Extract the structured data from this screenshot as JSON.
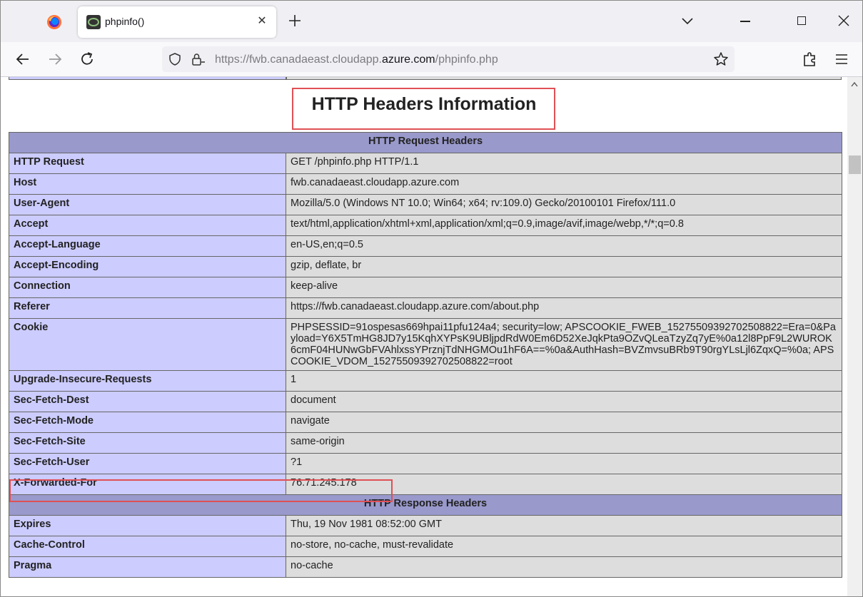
{
  "browser": {
    "tab_title": "phpinfo()",
    "url_prefix": "https://fwb.canadaeast.cloudapp.",
    "url_domain": "azure.com",
    "url_path": "/phpinfo.php"
  },
  "page": {
    "section_title": "HTTP Headers Information",
    "request_header_title": "HTTP Request Headers",
    "response_header_title": "HTTP Response Headers",
    "request_rows": [
      {
        "name": "HTTP Request",
        "value": "GET /phpinfo.php HTTP/1.1"
      },
      {
        "name": "Host",
        "value": "fwb.canadaeast.cloudapp.azure.com"
      },
      {
        "name": "User-Agent",
        "value": "Mozilla/5.0 (Windows NT 10.0; Win64; x64; rv:109.0) Gecko/20100101 Firefox/111.0"
      },
      {
        "name": "Accept",
        "value": "text/html,application/xhtml+xml,application/xml;q=0.9,image/avif,image/webp,*/*;q=0.8"
      },
      {
        "name": "Accept-Language",
        "value": "en-US,en;q=0.5"
      },
      {
        "name": "Accept-Encoding",
        "value": "gzip, deflate, br"
      },
      {
        "name": "Connection",
        "value": "keep-alive"
      },
      {
        "name": "Referer",
        "value": "https://fwb.canadaeast.cloudapp.azure.com/about.php"
      },
      {
        "name": "Cookie",
        "value": "PHPSESSID=91ospesas669hpai11pfu124a4; security=low; APSCOOKIE_FWEB_1527550939270250882​2=Era=0&Payload=Y6X5TmHG8JD7y15KqhXYPsK9UBljpdRdW0Em6D52XeJqkPta9OZvQLeaTzyZq7yE%0a12l8PpF9L2WUROK6cmF04HUNwGbFVAhlxssYPrznjTdNHGMOu1hF6A==%0a&AuthHash=BVZmvsuBRb9T90rgYLsLjl6ZqxQ=%0a; APSCOOKIE_VDOM_1527550939270250882​2=root"
      },
      {
        "name": "Upgrade-Insecure-Requests",
        "value": "1"
      },
      {
        "name": "Sec-Fetch-Dest",
        "value": "document"
      },
      {
        "name": "Sec-Fetch-Mode",
        "value": "navigate"
      },
      {
        "name": "Sec-Fetch-Site",
        "value": "same-origin"
      },
      {
        "name": "Sec-Fetch-User",
        "value": "?1"
      },
      {
        "name": "X-Forwarded-For",
        "value": "76.71.245.178"
      }
    ],
    "response_rows": [
      {
        "name": "Expires",
        "value": "Thu, 19 Nov 1981 08:52:00 GMT"
      },
      {
        "name": "Cache-Control",
        "value": "no-store, no-cache, must-revalidate"
      },
      {
        "name": "Pragma",
        "value": "no-cache"
      }
    ]
  },
  "colors": {
    "header_bg": "#9999cc",
    "name_cell_bg": "#ccccff",
    "value_cell_bg": "#dddddd",
    "highlight": "#e05055"
  }
}
